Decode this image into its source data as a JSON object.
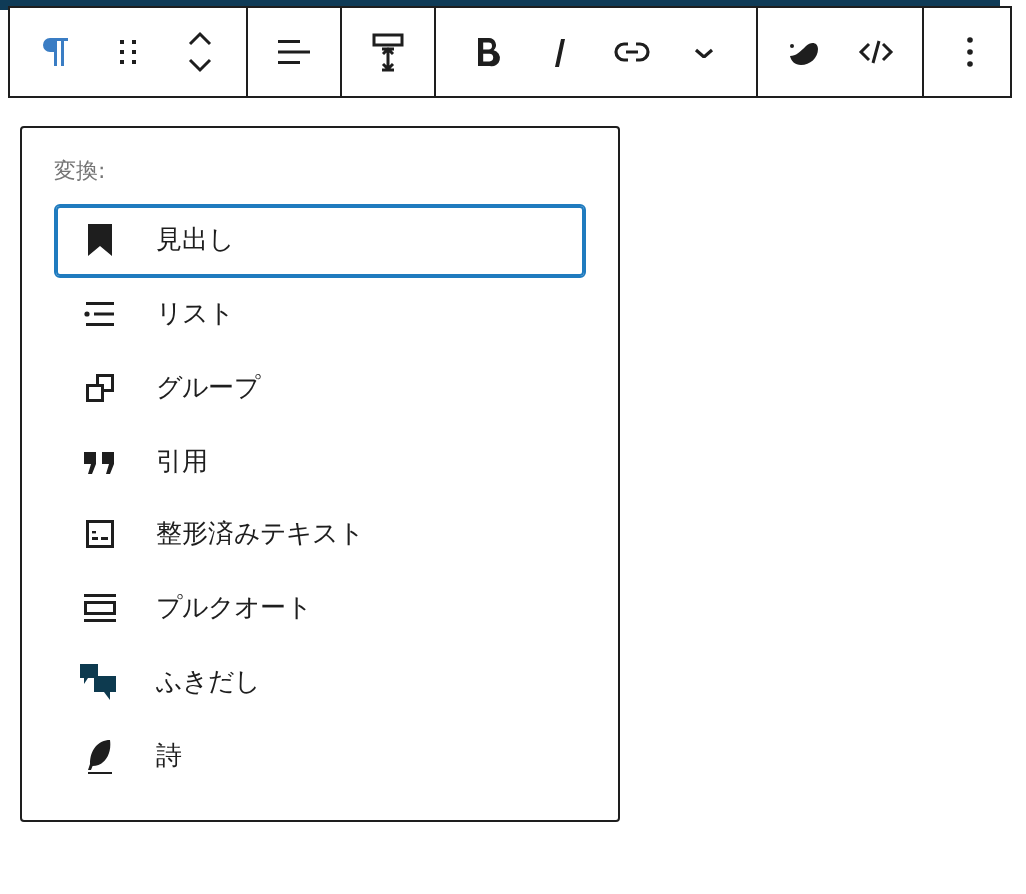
{
  "toolbar": {
    "groups": [
      {
        "buttons": [
          {
            "kind": "paragraph",
            "selected": true
          },
          {
            "kind": "drag",
            "selected": false
          },
          {
            "kind": "move",
            "selected": false
          }
        ]
      },
      {
        "buttons": [
          {
            "kind": "align",
            "selected": false
          }
        ]
      },
      {
        "buttons": [
          {
            "kind": "height",
            "selected": false
          }
        ]
      },
      {
        "buttons": [
          {
            "kind": "bold",
            "selected": false
          },
          {
            "kind": "italic",
            "selected": false
          },
          {
            "kind": "link",
            "selected": false
          },
          {
            "kind": "more-format",
            "selected": false
          }
        ]
      },
      {
        "buttons": [
          {
            "kind": "blob",
            "selected": false
          },
          {
            "kind": "code",
            "selected": false
          }
        ]
      },
      {
        "buttons": [
          {
            "kind": "options",
            "selected": false
          }
        ]
      }
    ]
  },
  "transform_menu": {
    "label": "変換:",
    "items": [
      {
        "kind": "heading",
        "label": "見出し",
        "selected": true
      },
      {
        "kind": "list",
        "label": "リスト",
        "selected": false
      },
      {
        "kind": "group",
        "label": "グループ",
        "selected": false
      },
      {
        "kind": "quote",
        "label": "引用",
        "selected": false
      },
      {
        "kind": "preformatted",
        "label": "整形済みテキスト",
        "selected": false
      },
      {
        "kind": "pullquote",
        "label": "プルクオート",
        "selected": false
      },
      {
        "kind": "speech",
        "label": "ふきだし",
        "selected": false
      },
      {
        "kind": "verse",
        "label": "詩",
        "selected": false
      }
    ]
  }
}
